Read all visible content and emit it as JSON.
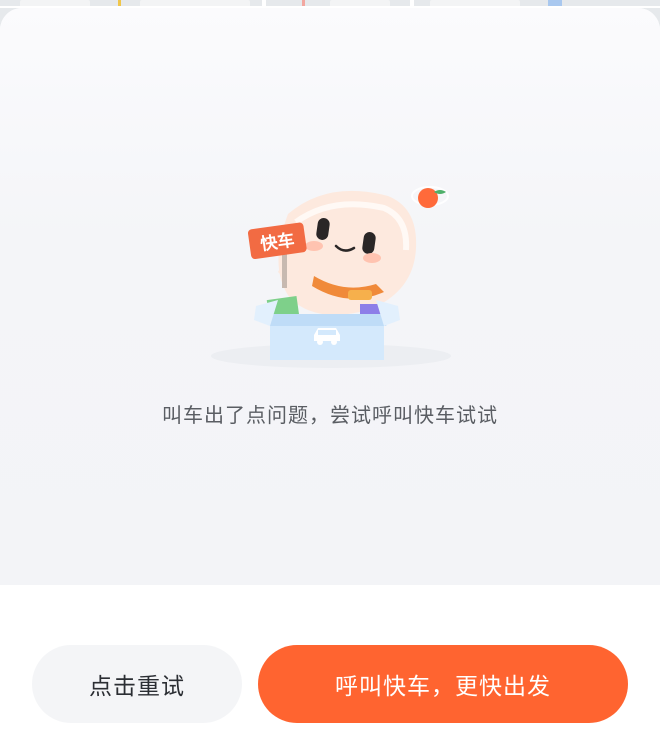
{
  "sheet": {
    "message": "叫车出了点问题，尝试呼叫快车试试",
    "illustration": {
      "sign_text": "快车",
      "icon": "car-icon"
    }
  },
  "buttons": {
    "retry_label": "点击重试",
    "call_label": "呼叫快车，更快出发"
  },
  "colors": {
    "primary": "#ff6430",
    "secondary_bg": "#f4f5f7",
    "box": "#cfe6fb",
    "text": "#5a5d63"
  }
}
